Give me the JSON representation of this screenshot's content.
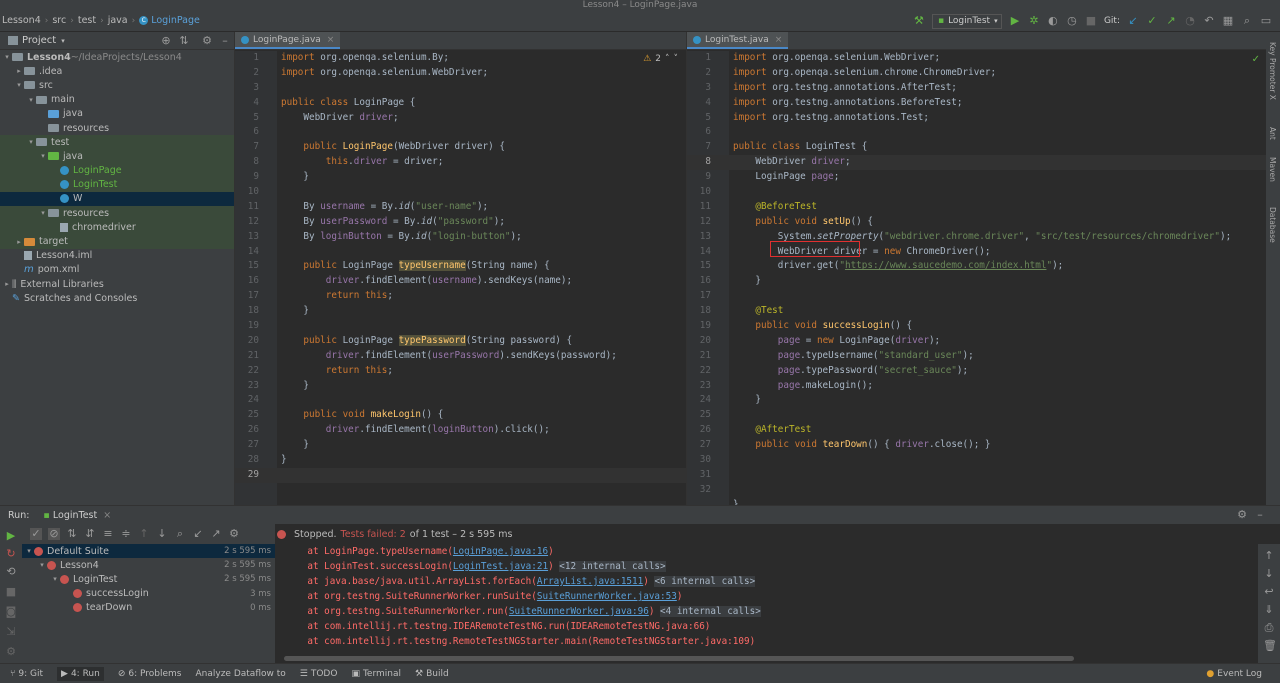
{
  "window": {
    "title": "Lesson4 – LoginPage.java"
  },
  "breadcrumb": [
    "Lesson4",
    "src",
    "test",
    "java",
    "LoginPage"
  ],
  "toolbar": {
    "run_config": "LoginTest",
    "git_label": "Git:"
  },
  "project": {
    "header": "Project",
    "tree": [
      {
        "label": "Lesson4",
        "note": "~/IdeaProjects/Lesson4",
        "indent": 0,
        "arrow": "▾",
        "icon": "folder"
      },
      {
        "label": ".idea",
        "indent": 1,
        "arrow": "▸",
        "icon": "folder"
      },
      {
        "label": "src",
        "indent": 1,
        "arrow": "▾",
        "icon": "folder"
      },
      {
        "label": "main",
        "indent": 2,
        "arrow": "▾",
        "icon": "folder"
      },
      {
        "label": "java",
        "indent": 3,
        "arrow": "",
        "icon": "folder-blue"
      },
      {
        "label": "resources",
        "indent": 3,
        "arrow": "",
        "icon": "folder"
      },
      {
        "label": "test",
        "indent": 2,
        "arrow": "▾",
        "icon": "folder",
        "hl": true
      },
      {
        "label": "java",
        "indent": 3,
        "arrow": "▾",
        "icon": "folder-green",
        "hl": true
      },
      {
        "label": "LoginPage",
        "indent": 4,
        "arrow": "",
        "icon": "class",
        "hl": true,
        "green": true
      },
      {
        "label": "LoginTest",
        "indent": 4,
        "arrow": "",
        "icon": "class",
        "hl": true,
        "green": true
      },
      {
        "label": "W",
        "indent": 4,
        "arrow": "",
        "icon": "class",
        "sel": true
      },
      {
        "label": "resources",
        "indent": 3,
        "arrow": "▾",
        "icon": "folder",
        "hl": true
      },
      {
        "label": "chromedriver",
        "indent": 4,
        "arrow": "",
        "icon": "file",
        "hl": true
      },
      {
        "label": "target",
        "indent": 1,
        "arrow": "▸",
        "icon": "folder-orange",
        "hl": true
      },
      {
        "label": "Lesson4.iml",
        "indent": 1,
        "arrow": "",
        "icon": "file"
      },
      {
        "label": "pom.xml",
        "indent": 1,
        "arrow": "",
        "icon": "maven"
      },
      {
        "label": "External Libraries",
        "indent": 0,
        "arrow": "▸",
        "icon": "lib"
      },
      {
        "label": "Scratches and Consoles",
        "indent": 0,
        "arrow": "",
        "icon": "scratch"
      }
    ]
  },
  "editor_left": {
    "tab": "LoginPage.java",
    "warning": "2",
    "lines": [
      "<span class=\"kw\">import</span> org.openqa.selenium.By;",
      "<span class=\"kw\">import</span> org.openqa.selenium.WebDriver;",
      "",
      "<span class=\"kw\">public class</span> LoginPage {",
      "    WebDriver <span class=\"fld\">driver</span>;",
      "",
      "    <span class=\"kw\">public</span> <span class=\"mth\">LoginPage</span>(WebDriver driver) {",
      "        <span class=\"kw\">this</span>.<span class=\"fld\">driver</span> = driver;",
      "    }",
      "",
      "    By <span class=\"fld\">username</span> = By.<span class=\"it\">id</span>(<span class=\"str\">\"user-name\"</span>);",
      "    By <span class=\"fld\">userPassword</span> = By.<span class=\"it\">id</span>(<span class=\"str\">\"password\"</span>);",
      "    By <span class=\"fld\">loginButton</span> = By.<span class=\"it\">id</span>(<span class=\"str\">\"login-button\"</span>);",
      "",
      "    <span class=\"kw\">public</span> LoginPage <span class=\"mth hlw\">typeUsername</span>(String name) {",
      "        <span class=\"fld\">driver</span>.findElement(<span class=\"fld\">username</span>).sendKeys(name);",
      "        <span class=\"kw\">return this</span>;",
      "    }",
      "",
      "    <span class=\"kw\">public</span> LoginPage <span class=\"mth hlw\">typePassword</span>(String password) {",
      "        <span class=\"fld\">driver</span>.findElement(<span class=\"fld\">userPassword</span>).sendKeys(password);",
      "        <span class=\"kw\">return this</span>;",
      "    }",
      "",
      "    <span class=\"kw\">public void</span> <span class=\"mth\">makeLogin</span>() {",
      "        <span class=\"fld\">driver</span>.findElement(<span class=\"fld\">loginButton</span>).click();",
      "    }",
      "}",
      ""
    ],
    "current_line": 29
  },
  "editor_right": {
    "tab": "LoginTest.java",
    "lines": [
      "<span class=\"kw\">import</span> org.openqa.selenium.WebDriver;",
      "<span class=\"kw\">import</span> org.openqa.selenium.chrome.ChromeDriver;",
      "<span class=\"kw\">import</span> org.testng.annotations.AfterTest;",
      "<span class=\"kw\">import</span> org.testng.annotations.BeforeTest;",
      "<span class=\"kw\">import</span> org.testng.annotations.Test;",
      "",
      "<span class=\"kw\">public class</span> LoginTest {",
      "    WebDriver <span class=\"fld\">driver</span>;",
      "    LoginPage <span class=\"fld\">page</span>;",
      "",
      "    <span class=\"ann\">@BeforeTest</span>",
      "    <span class=\"kw\">public void</span> <span class=\"mth\">setUp</span>() {",
      "        System.<span class=\"it\">setProperty</span>(<span class=\"str\">\"webdriver.chrome.driver\"</span>, <span class=\"str\">\"src/test/resources/chromedriver\"</span>);",
      "        WebDriver driver = <span class=\"kw\">new</span> ChromeDriver();",
      "        driver.get(<span class=\"str\">\"<u>https://www.saucedemo.com/index.html</u>\"</span>);",
      "    }",
      "",
      "    <span class=\"ann\">@Test</span>",
      "    <span class=\"kw\">public void</span> <span class=\"mth\">successLogin</span>() {",
      "        <span class=\"fld\">page</span> = <span class=\"kw\">new</span> LoginPage(<span class=\"fld\">driver</span>);",
      "        <span class=\"fld\">page</span>.typeUsername(<span class=\"str\">\"standard_user\"</span>);",
      "        <span class=\"fld\">page</span>.typePassword(<span class=\"str\">\"secret_sauce\"</span>);",
      "        <span class=\"fld\">page</span>.makeLogin();",
      "    }",
      "",
      "    <span class=\"ann\">@AfterTest</span>",
      "    <span class=\"kw\">public void</span> <span class=\"mth\">tearDown</span>() { <span class=\"fld\">driver</span>.close(); }",
      "",
      "",
      "",
      "}",
      ""
    ],
    "line_numbers": [
      1,
      2,
      3,
      4,
      5,
      6,
      7,
      8,
      9,
      10,
      11,
      12,
      13,
      14,
      15,
      16,
      17,
      18,
      19,
      20,
      21,
      22,
      23,
      24,
      25,
      26,
      27,
      30,
      31,
      32
    ],
    "current_line": 8
  },
  "right_strip": [
    "Key Promoter X",
    "Ant",
    "Maven",
    "Database"
  ],
  "run": {
    "label": "Run:",
    "tab": "LoginTest",
    "status_stopped": "Stopped.",
    "status_failed": "Tests failed: 2",
    "status_rest": "of 1 test – 2 s 595 ms",
    "tests": [
      {
        "label": "Default Suite",
        "time": "2 s 595 ms",
        "indent": 0,
        "arrow": "▾",
        "sel": true
      },
      {
        "label": "Lesson4",
        "time": "2 s 595 ms",
        "indent": 1,
        "arrow": "▾"
      },
      {
        "label": "LoginTest",
        "time": "2 s 595 ms",
        "indent": 2,
        "arrow": "▾"
      },
      {
        "label": "successLogin",
        "time": "3 ms",
        "indent": 3,
        "arrow": ""
      },
      {
        "label": "tearDown",
        "time": "0 ms",
        "indent": 3,
        "arrow": ""
      }
    ],
    "console": [
      "    at LoginPage.typeUsername(<span class=\"clink\">LoginPage.java:16</span>)",
      "    at LoginTest.successLogin(<span class=\"clink\">LoginTest.java:21</span>) <span class=\"internal\">&lt;12 internal calls&gt;</span>",
      "    at java.base/java.util.ArrayList.forEach(<span class=\"clink\">ArrayList.java:1511</span>) <span class=\"internal\">&lt;6 internal calls&gt;</span>",
      "    at org.testng.SuiteRunnerWorker.runSuite(<span class=\"clink\">SuiteRunnerWorker.java:53</span>)",
      "    at org.testng.SuiteRunnerWorker.run(<span class=\"clink\">SuiteRunnerWorker.java:96</span>) <span class=\"internal\">&lt;4 internal calls&gt;</span>",
      "    at com.intellij.rt.testng.IDEARemoteTestNG.run(IDEARemoteTestNG.java:66)",
      "    at com.intellij.rt.testng.RemoteTestNGStarter.main(RemoteTestNGStarter.java:109)"
    ]
  },
  "bottom_bar": {
    "items": [
      "9: Git",
      "4: Run",
      "6: Problems",
      "Analyze Dataflow to",
      "TODO",
      "Terminal",
      "Build"
    ],
    "event_log": "Event Log"
  },
  "colors": {
    "accent": "#4a88c7",
    "error": "#c75450",
    "success": "#62b543"
  }
}
